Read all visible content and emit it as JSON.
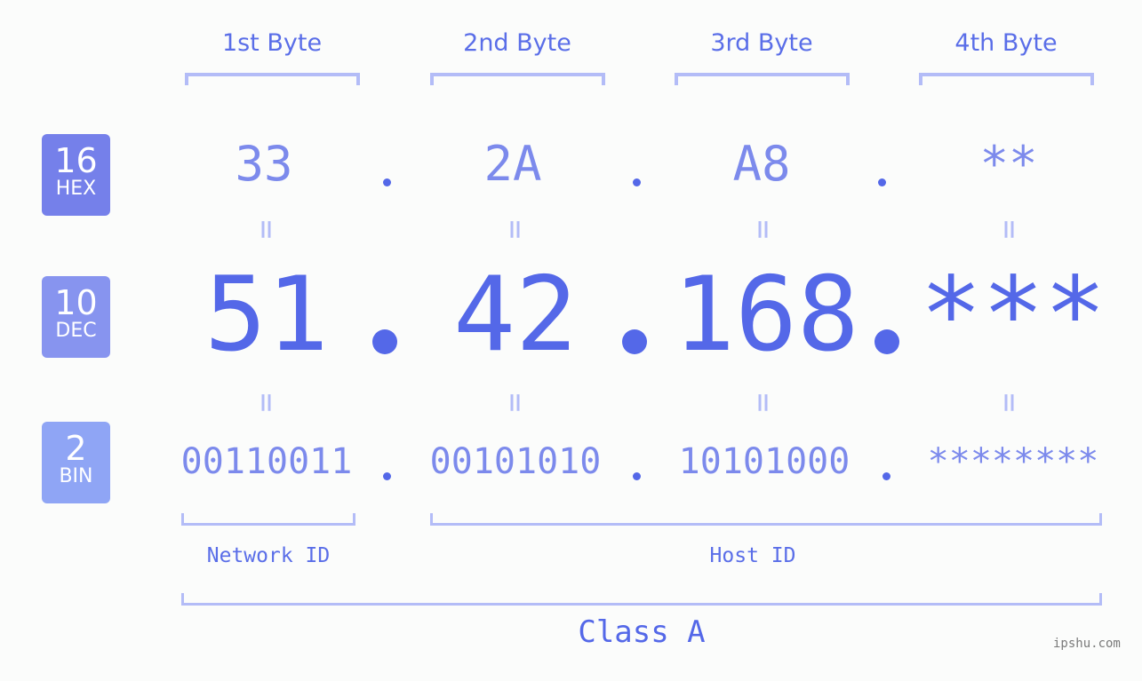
{
  "byte_headers": [
    "1st Byte",
    "2nd Byte",
    "3rd Byte",
    "4th Byte"
  ],
  "rows": {
    "hex": {
      "base": "16",
      "label": "HEX",
      "color": "#7580ea",
      "values": [
        "33",
        "2A",
        "A8",
        "**"
      ]
    },
    "dec": {
      "base": "10",
      "label": "DEC",
      "color": "#8794ef",
      "values": [
        "51",
        "42",
        "168",
        "***"
      ]
    },
    "bin": {
      "base": "2",
      "label": "BIN",
      "color": "#8fa5f5",
      "values": [
        "00110011",
        "00101010",
        "10101000",
        "********"
      ]
    }
  },
  "equals_sign": "=",
  "network_id_label": "Network ID",
  "host_id_label": "Host ID",
  "class_label": "Class A",
  "watermark": "ipshu.com",
  "colors": {
    "primary": "#5468e8",
    "secondary": "#7c8aec",
    "bracket": "#b3bcf7",
    "background": "#fbfcfb"
  }
}
